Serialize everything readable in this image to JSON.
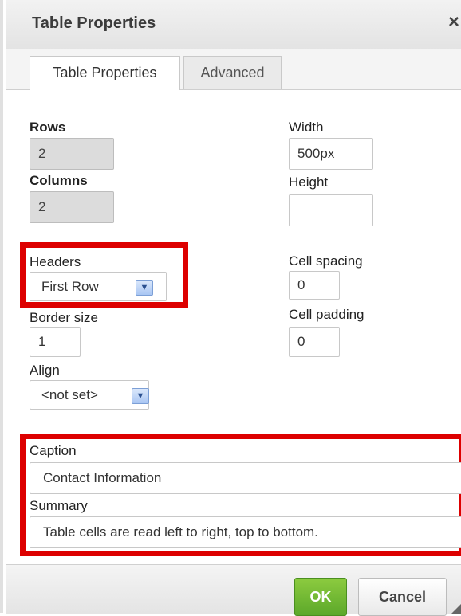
{
  "dialog": {
    "title": "Table Properties",
    "close_glyph": "×"
  },
  "tabs": [
    {
      "label": "Table Properties",
      "active": true
    },
    {
      "label": "Advanced",
      "active": false
    }
  ],
  "fields": {
    "rows_label": "Rows",
    "rows_value": "2",
    "columns_label": "Columns",
    "columns_value": "2",
    "width_label": "Width",
    "width_value": "500px",
    "height_label": "Height",
    "height_value": "",
    "headers_label": "Headers",
    "headers_value": "First Row",
    "border_size_label": "Border size",
    "border_size_value": "1",
    "cell_spacing_label": "Cell spacing",
    "cell_spacing_value": "0",
    "cell_padding_label": "Cell padding",
    "cell_padding_value": "0",
    "align_label": "Align",
    "align_value": "<not set>",
    "caption_label": "Caption",
    "caption_value": "Contact Information",
    "summary_label": "Summary",
    "summary_value": "Table cells are read left to right, top to bottom."
  },
  "buttons": {
    "ok": "OK",
    "cancel": "Cancel"
  },
  "colors": {
    "highlight": "#dd0000",
    "ok_green": "#6cb531",
    "select_arrow": "#a9c6f3"
  },
  "icons": {
    "close": "close-icon",
    "dropdown": "chevron-down-icon",
    "resize": "resize-grip-icon"
  }
}
